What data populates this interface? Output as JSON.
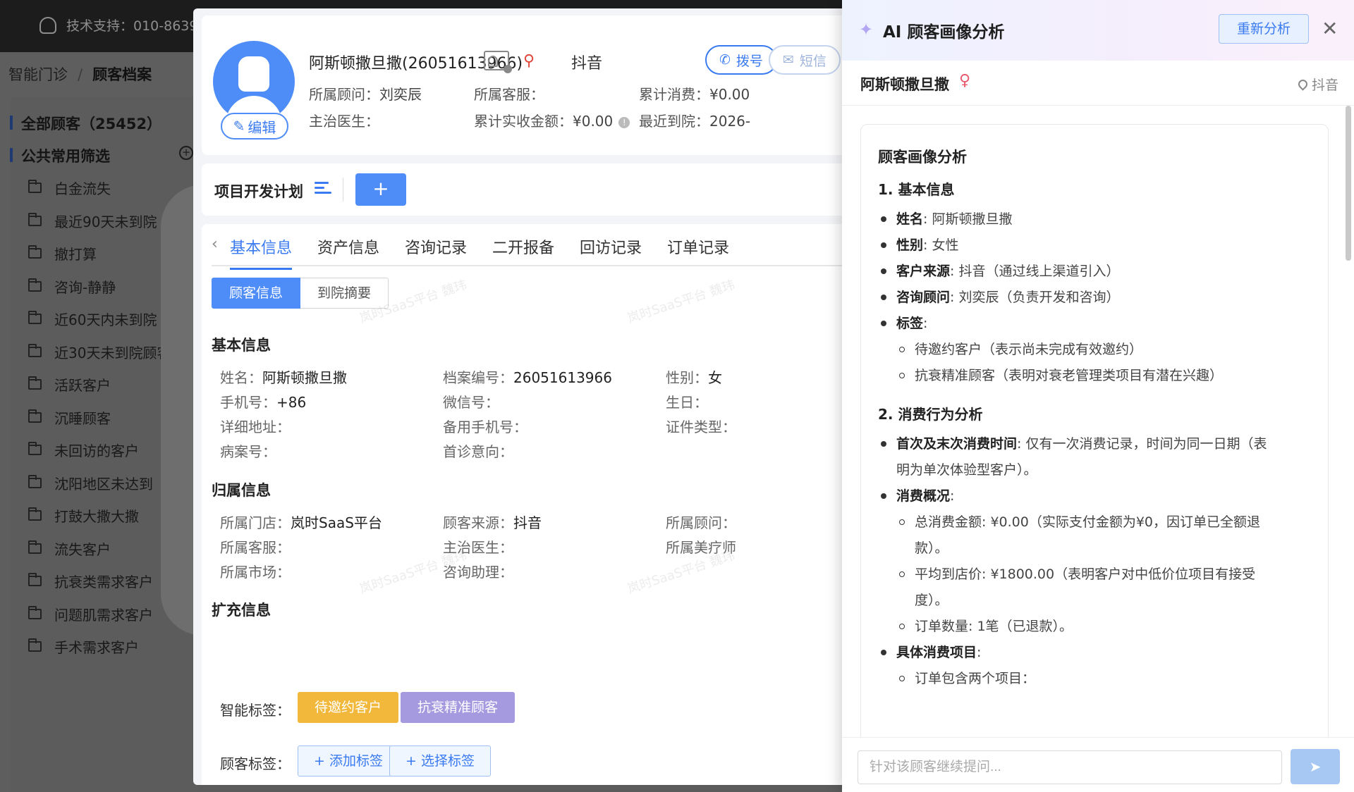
{
  "topbar": {
    "support": "技术支持：010-8639"
  },
  "breadcrumb": {
    "root": "智能门诊",
    "sep": "/",
    "current": "顾客档案"
  },
  "sidebar": {
    "all": "全部顾客（25452）",
    "common": "公共常用筛选",
    "items": [
      "白金流失",
      "最近90天未到院",
      "撤打算",
      "咨询-静静",
      "近60天内未到院",
      "近30天未到院顾客",
      "活跃客户",
      "沉睡顾客",
      "未回访的客户",
      "沈阳地区未达到",
      "打鼓大撒大撒",
      "流失客户",
      "抗衰类需求客户",
      "问题肌需求客户",
      "手术需求客户"
    ]
  },
  "profile": {
    "name": "阿斯顿撒旦撒(26051613966)",
    "source": "抖音",
    "edit": "编辑",
    "call": "拨号",
    "sms": "短信",
    "consultant_label": "所属顾问：",
    "consultant": "刘奕辰",
    "service_label": "所属客服：",
    "spend_label": "累计消费：",
    "spend": "¥0.00",
    "doctor_label": "主治医生：",
    "received_label": "累计实收金额：",
    "received": "¥0.00",
    "recent_label": "最近到院：",
    "recent": "2026-"
  },
  "plan": {
    "title": "项目开发计划",
    "add": "+"
  },
  "tabs": [
    "基本信息",
    "资产信息",
    "咨询记录",
    "二开报备",
    "回访记录",
    "订单记录"
  ],
  "segments": [
    "顾客信息",
    "到院摘要"
  ],
  "basic": {
    "title": "基本信息",
    "name_l": "姓名：",
    "name_v": "阿斯顿撒旦撒",
    "no_l": "档案编号：",
    "no_v": "26051613966",
    "sex_l": "性别：",
    "sex_v": "女",
    "phone_l": "手机号：",
    "phone_v": "+86",
    "wechat_l": "微信号：",
    "birth_l": "生日：",
    "addr_l": "详细地址：",
    "phone2_l": "备用手机号：",
    "cert_l": "证件类型：",
    "case_l": "病案号：",
    "intent_l": "首诊意向："
  },
  "belong": {
    "title": "归属信息",
    "store_l": "所属门店：",
    "store_v": "岚时SaaS平台",
    "source_l": "顾客来源：",
    "source_v": "抖音",
    "consult_l": "所属顾问：",
    "service_l": "所属客服：",
    "doctor_l": "主治医生：",
    "therapist_l": "所属美疗师",
    "market_l": "所属市场：",
    "assist_l": "咨询助理："
  },
  "ext": {
    "title": "扩充信息",
    "smart_l": "智能标签：",
    "smart_tags": [
      "待邀约客户",
      "抗衰精准顾客"
    ],
    "cust_l": "顾客标签：",
    "add_tag": "+ 添加标签",
    "select_tag": "+ 选择标签"
  },
  "watermark": "岚时SaaS平台 魏玮",
  "ai": {
    "title": "AI 顾客画像分析",
    "reanalyze": "重新分析",
    "close": "✕",
    "customer": "阿斯顿撒旦撒",
    "source": "抖音",
    "heading": "顾客画像分析",
    "sec1": "1. 基本信息",
    "basic": [
      {
        "k": "姓名",
        "v": ": 阿斯顿撒旦撒"
      },
      {
        "k": "性别",
        "v": ": 女性"
      },
      {
        "k": "客户来源",
        "v": ": 抖音（通过线上渠道引入）"
      },
      {
        "k": "咨询顾问",
        "v": ": 刘奕辰（负责开发和咨询）"
      },
      {
        "k": "标签",
        "v": ":"
      }
    ],
    "tags": [
      "待邀约客户（表示尚未完成有效邀约）",
      "抗衰精准顾客（表明对衰老管理类项目有潜在兴趣）"
    ],
    "sec2": "2. 消费行为分析",
    "first_last_k": "首次及末次消费时间",
    "first_last_v": ": 仅有一次消费记录，时间为同一日期（表",
    "first_last_v2": "明为单次体验型客户）。",
    "overview_k": "消费概况",
    "overview_v": ":",
    "overview": [
      "总消费金额: ¥0.00（实际支付金额为¥0，因订单已全额退",
      "款）。",
      "平均到店价: ¥1800.00（表明客户对中低价位项目有接受",
      "度）。",
      "订单数量: 1笔（已退款）。"
    ],
    "items_k": "具体消费项目",
    "items_v": ":",
    "items_sub": "订单包含两个项目：",
    "input_placeholder": "针对该顾客继续提问...",
    "send": "➤"
  }
}
